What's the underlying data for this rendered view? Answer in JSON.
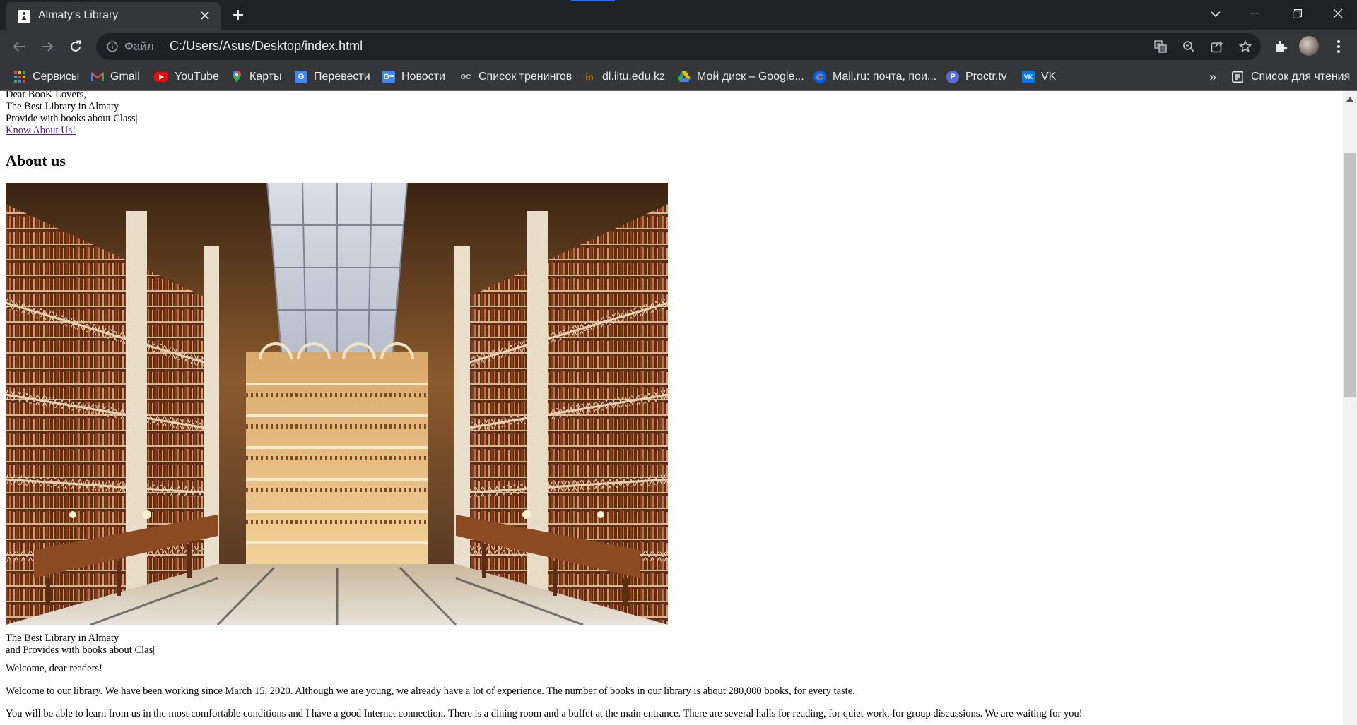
{
  "browser": {
    "tab_title": "Almaty's Library",
    "scheme_label": "Файл",
    "url": "C:/Users/Asus/Desktop/index.html"
  },
  "bookmarks": {
    "items": [
      {
        "label": "Сервисы",
        "icon": "apps-grid-icon"
      },
      {
        "label": "Gmail",
        "icon": "gmail-icon"
      },
      {
        "label": "YouTube",
        "icon": "youtube-icon"
      },
      {
        "label": "Карты",
        "icon": "maps-pin-icon"
      },
      {
        "label": "Перевести",
        "icon": "translate-icon"
      },
      {
        "label": "Новости",
        "icon": "news-icon"
      },
      {
        "label": "Список тренингов",
        "icon": "gc-icon"
      },
      {
        "label": "dl.iitu.edu.kz",
        "icon": "iitu-icon"
      },
      {
        "label": "Мой диск – Google...",
        "icon": "google-drive-icon"
      },
      {
        "label": "Mail.ru: почта, пои...",
        "icon": "mailru-icon"
      },
      {
        "label": "Proctr.tv",
        "icon": "proctr-icon"
      },
      {
        "label": "VK",
        "icon": "vk-icon"
      }
    ],
    "more_label": "»",
    "reading_list_label": "Список для чтения"
  },
  "page": {
    "intro_lines": [
      "Dear BooK Lovers,",
      "The Best Library in Almaty",
      "Provide with books about Class|"
    ],
    "link_label": "Know About Us!",
    "heading": "About us",
    "photo_caption_lines": [
      "The Best Library in Almaty",
      "and Provides with books about Clas|"
    ],
    "paragraphs": [
      "Welcome, dear readers!",
      "Welcome to our library. We have been working since March 15, 2020. Although we are young, we already have a lot of experience. The number of books in our library is about 280,000 books, for every taste.",
      "You will be able to learn from us in the most comfortable conditions and I have a good Internet connection. There is a dining room and a buffet at the main entrance. There are several halls for reading, for quiet work, for group discussions. We are waiting for you!"
    ]
  },
  "colors": {
    "titlebar": "#202124",
    "toolbar": "#35363a",
    "visited_link": "#551a8b",
    "accent": "#1a73e8"
  }
}
